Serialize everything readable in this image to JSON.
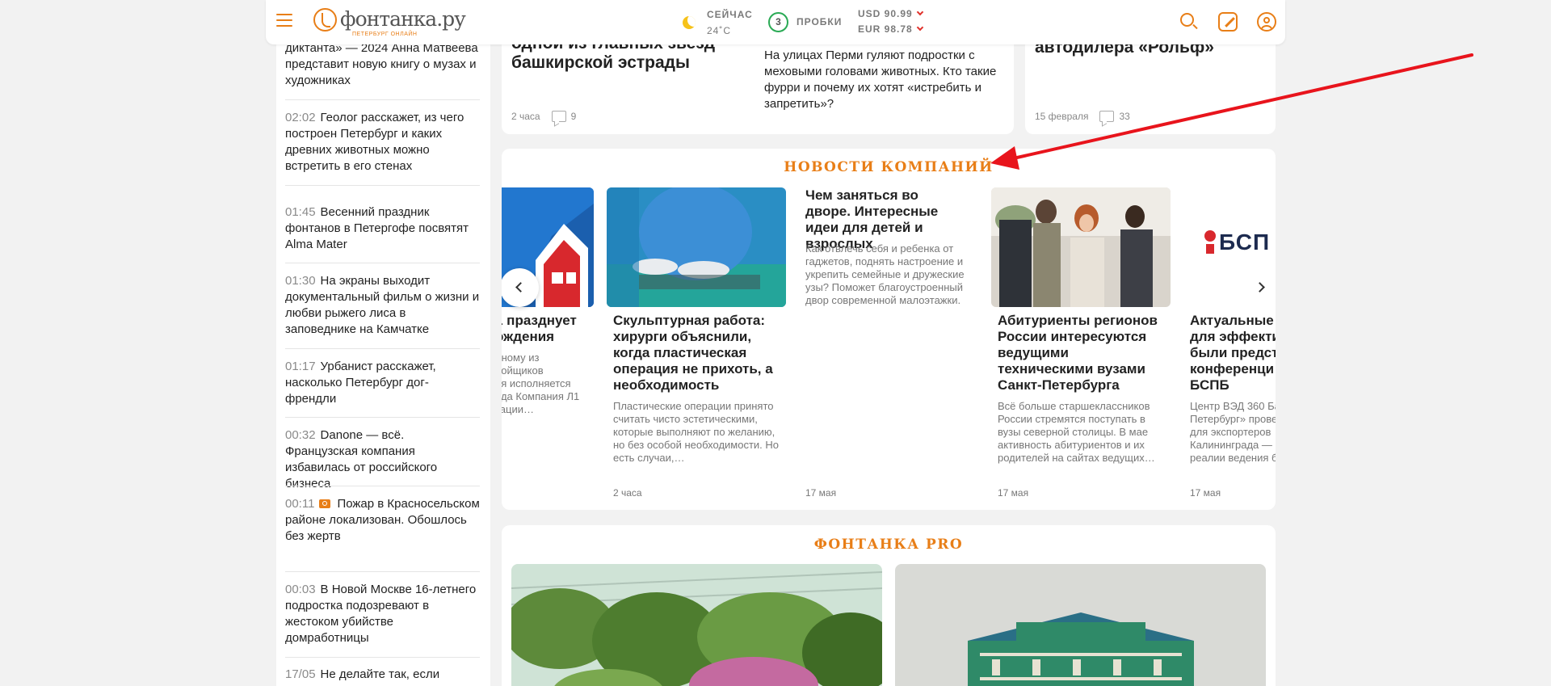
{
  "header": {
    "logo_title": "фонтанка.ру",
    "logo_sub": "ПЕТЕРБУРГ ОНЛАЙН",
    "weather_now": "СЕЙЧАС",
    "weather_temp": "24˚C",
    "traffic_level": "3",
    "traffic_label": "ПРОБКИ",
    "rate_usd": "USD 90.99",
    "rate_eur": "EUR 98.78"
  },
  "feed": {
    "items": [
      {
        "time": "",
        "text": "диктанта» — 2024 Анна Матвеева представит новую книгу о музах и художниках"
      },
      {
        "time": "02:02",
        "text": "Геолог расскажет, из чего построен Петербург и каких древних животных можно встретить в его стенах"
      },
      {
        "time": "01:45",
        "text": "Весенний праздник фонтанов в Петергофе посвятят Alma Mater"
      },
      {
        "time": "01:30",
        "text": "На экраны выходит документальный фильм о жизни и любви рыжего лиса в заповеднике на Камчатке"
      },
      {
        "time": "01:17",
        "text": "Урбанист расскажет, насколько Петербург дог-френдли"
      },
      {
        "time": "00:32",
        "text": "Danone — всё. Французская компания избавилась от российского бизнеса"
      },
      {
        "time": "00:11",
        "text": "Пожар в Красносельском районе локализован. Обошлось без жертв"
      },
      {
        "time": "00:03",
        "text": "В Новой Москве 16-летнего подростка подозревают в жестоком убийстве домработницы"
      },
      {
        "time": "17/05",
        "text": "Не делайте так, если"
      }
    ]
  },
  "top_cards": {
    "card1_title": "одной из главных звезд башкирской эстрады",
    "card1_time": "2 часа",
    "card1_comments": "9",
    "card2_desc": "На улицах Перми гуляют подростки с меховыми головами животных. Кто такие фурри и почему их хотят «истребить и запретить»?",
    "card3_title": "автодилера «Рольф»",
    "card3_time": "15 февраля",
    "card3_comments": "33"
  },
  "company_news": {
    "title": "НОВОСТИ КОМПАНИЙ",
    "slides": [
      {
        "title": "1 празднует\nождения",
        "desc": "дному из\nройщиков\nая исполняется\nода Компания Л1\nтации…",
        "date": ""
      },
      {
        "title": "Скульптурная работа: хирурги объяснили, когда пластическая операция не прихоть, а необходимость",
        "desc": "Пластические операции принято считать чисто эстетическими, которые выполняют по желанию, но без особой необходимости. Но есть случаи,…",
        "date": "2 часа"
      },
      {
        "title": "Чем заняться во дворе. Интересные идеи для детей и взрослых",
        "desc": "Как отвлечь себя и ребенка от гаджетов, поднять настроение и укрепить семейные и дружеские узы? Поможет благоустроенный двор современной малоэтажки.",
        "date": "17 мая"
      },
      {
        "title": "Абитуриенты регионов России интересуются ведущими техническими вузами Санкт-Петербурга",
        "desc": "Всё больше старшеклассников России стремятся поступать в вузы северной столицы. В мае активность абитуриентов и их родителей на сайтах ведущих…",
        "date": "17 мая"
      },
      {
        "title": "Актуальные р\nдля эффекти\nбыли предста\nконференци\nБСПБ",
        "desc": "Центр ВЭД 360 Ба\nПетербург» прове\nдля экспортеров\nКалининграда —\nреалии ведения б",
        "date": "17 мая",
        "logo": "БСП"
      }
    ]
  },
  "pro": {
    "title": "ФОНТАНКА PRO"
  },
  "colors": {
    "accent": "#e87e17",
    "arrow": "#e8141c",
    "traffic": "#2aaa55"
  }
}
